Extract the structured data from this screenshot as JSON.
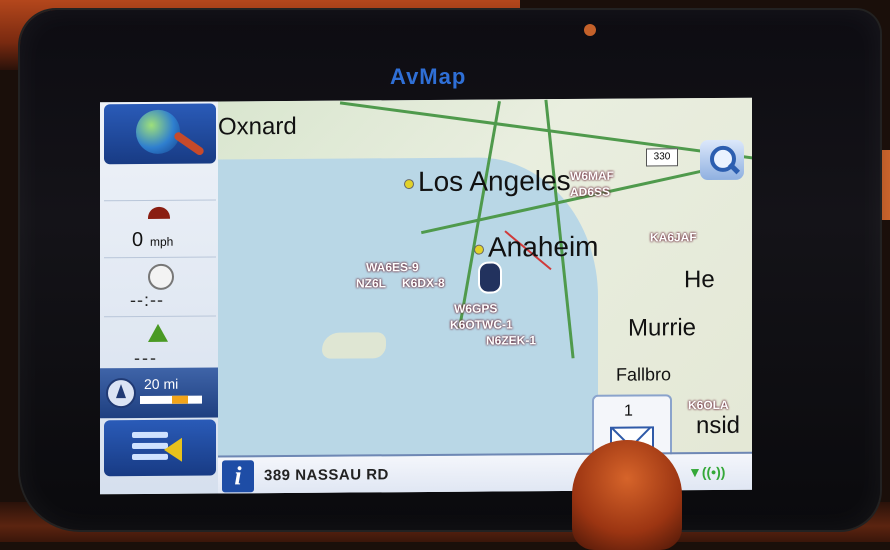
{
  "device": {
    "brand": "AvMap"
  },
  "sidebar": {
    "speed": {
      "value": "0",
      "unit": "mph"
    },
    "eta": {
      "value": "--:--"
    },
    "distance": {
      "value": "---"
    },
    "scale": {
      "label": "20 mi",
      "level": 0.6
    }
  },
  "map": {
    "cities": [
      "Oxnard",
      "Los Angeles",
      "Anaheim",
      "He",
      "Murrie",
      "Fallbro",
      "nsid"
    ],
    "highway_shield": "330",
    "station_labels": [
      "W6MAF",
      "AD6SS",
      "KA6JAF",
      "WA6ES-9",
      "NZ6L",
      "K6DX-8",
      "W6GPS",
      "K6OTWC-1",
      "N6ZEK-1",
      "K6OLA"
    ]
  },
  "message_button": {
    "count": "1"
  },
  "bottom_bar": {
    "street": "389 NASSAU RD",
    "info_icon": "i"
  },
  "colors": {
    "accent": "#1e4da6",
    "map_land": "#e4e8d6",
    "map_water": "#b9d7e6"
  }
}
